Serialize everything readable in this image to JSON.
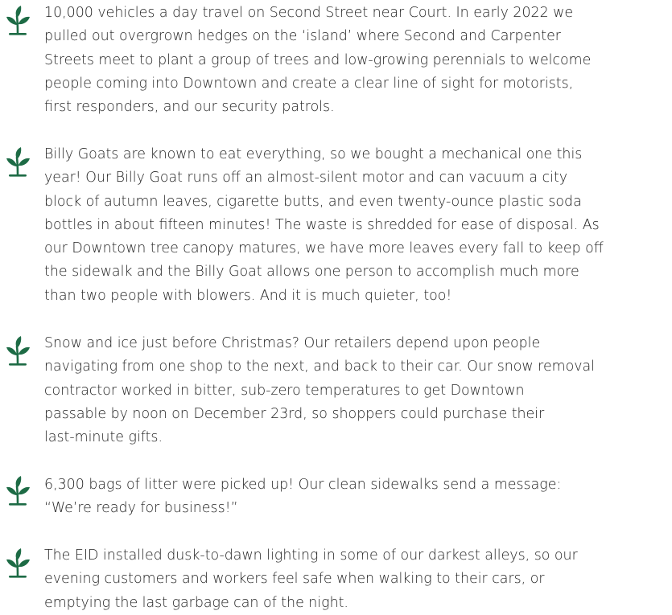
{
  "icon_color": "#1d6b45",
  "icon_name": "sprout-icon",
  "items": [
    {
      "lines": [
        "10,000 vehicles a day travel on Second Street near Court. In early 2022 we",
        "pulled out overgrown hedges on the ‘island’ where Second and Carpenter",
        "Streets meet to plant a group of trees and low-growing perennials to welcome",
        "people coming into Downtown and create a clear line of sight for motorists,",
        "first responders, and our security patrols."
      ]
    },
    {
      "lines": [
        "Billy Goats are known to eat everything, so we bought a mechanical one this",
        "year! Our Billy Goat runs off an almost-silent motor and can vacuum a city",
        "block of autumn leaves, cigarette butts, and even twenty-ounce plastic soda",
        "bottles in about fifteen minutes! The waste is shredded for ease of disposal. As",
        "our Downtown tree canopy matures, we have more leaves every fall to keep off",
        "the sidewalk and the Billy Goat allows one person to accomplish much more",
        "than two people with blowers. And it is much quieter, too!"
      ]
    },
    {
      "lines": [
        "Snow and ice just before Christmas? Our retailers depend upon people",
        "navigating from one shop to the next, and back to their car. Our snow removal",
        "contractor worked in bitter, sub-zero temperatures to get Downtown",
        "passable by noon on December 23rd, so shoppers could purchase their",
        "last-minute gifts."
      ]
    },
    {
      "lines": [
        "6,300 bags of litter were picked up! Our clean sidewalks send a message:",
        "“We’re ready for business!”"
      ]
    },
    {
      "lines": [
        "The EID installed dusk-to-dawn lighting in some of our darkest alleys, so our",
        "evening customers and workers feel safe when walking to their cars, or",
        "emptying the last garbage can of the night."
      ]
    }
  ]
}
